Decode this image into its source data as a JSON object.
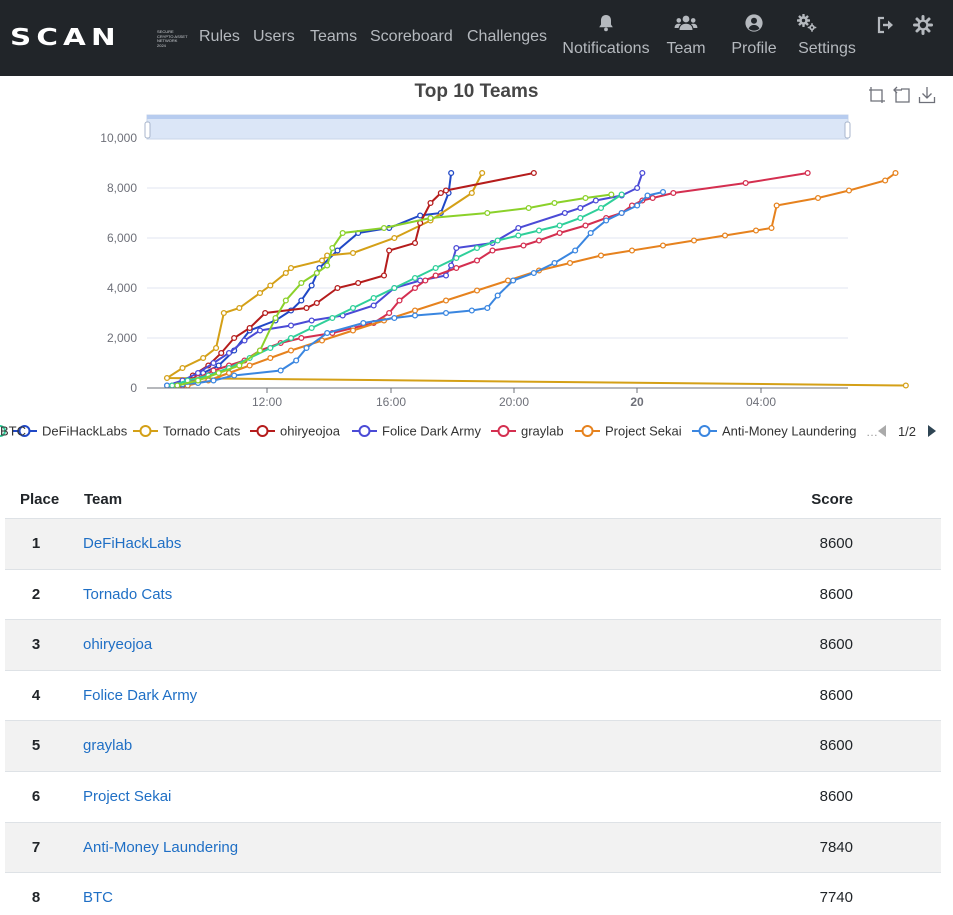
{
  "navbar": {
    "brand": "SCAN",
    "brand_subtitle": [
      "SECURE",
      "CRYPTO ASSET",
      "NETWORK",
      "2024"
    ],
    "links": [
      "Rules",
      "Users",
      "Teams",
      "Scoreboard",
      "Challenges"
    ],
    "notifications_label": "Notifications",
    "team_label": "Team",
    "profile_label": "Profile",
    "settings_label": "Settings",
    "icons": {
      "notifications": "bell-icon",
      "team": "users-icon",
      "profile": "user-circle-icon",
      "settings": "cogs-icon",
      "logout": "sign-out-icon",
      "theme": "sun-icon"
    }
  },
  "chart_data": {
    "type": "line",
    "title": "Top 10 Teams",
    "x_tick_labels": [
      "12:00",
      "16:00",
      "20:00",
      "20",
      "04:00"
    ],
    "y_tick_labels": [
      "0",
      "2,000",
      "4,000",
      "6,000",
      "8,000",
      "10,000"
    ],
    "ylim": [
      0,
      10000
    ],
    "legend_position": "bottom",
    "legend_page": "1/2",
    "grid": true,
    "series": [
      {
        "name": "DeFiHackLabs",
        "color": "#2048c6",
        "x": [
          "08:10",
          "08:40",
          "09:10",
          "09:40",
          "10:10",
          "10:40",
          "11:30",
          "12:00",
          "12:20",
          "12:40",
          "12:55",
          "13:30",
          "14:10",
          "15:10",
          "16:10",
          "16:50",
          "17:05",
          "17:10"
        ],
        "y": [
          100,
          300,
          600,
          900,
          1500,
          2300,
          2700,
          3100,
          3500,
          4100,
          4800,
          5500,
          6200,
          6400,
          6900,
          7000,
          7800,
          8600
        ]
      },
      {
        "name": "Tornado Cats",
        "color": "#d4a017",
        "x": [
          "07:50",
          "08:00",
          "08:30",
          "09:10",
          "09:35",
          "09:50",
          "10:20",
          "11:00",
          "11:20",
          "11:50",
          "12:00",
          "13:00",
          "13:10",
          "14:00",
          "15:20",
          "16:30",
          "17:50",
          "18:10"
        ],
        "y": [
          100,
          400,
          800,
          1200,
          1600,
          3000,
          3200,
          3800,
          4100,
          4600,
          4800,
          5100,
          5300,
          5400,
          6000,
          6700,
          7800,
          8600
        ]
      },
      {
        "name": "ohiryeojoa",
        "color": "#b51c1c",
        "x": [
          "08:20",
          "08:50",
          "09:20",
          "09:45",
          "10:10",
          "10:40",
          "11:10",
          "12:30",
          "12:50",
          "13:30",
          "14:10",
          "15:00",
          "15:10",
          "16:00",
          "16:10",
          "16:30",
          "16:50",
          "17:00",
          "19:50"
        ],
        "y": [
          100,
          500,
          900,
          1400,
          2000,
          2400,
          3000,
          3200,
          3400,
          4000,
          4200,
          4500,
          5500,
          5800,
          6600,
          7400,
          7800,
          7900,
          8600
        ]
      },
      {
        "name": "Folice Dark Army",
        "color": "#4b4bd6",
        "x": [
          "08:00",
          "08:30",
          "09:00",
          "09:30",
          "10:00",
          "10:30",
          "11:00",
          "12:00",
          "12:40",
          "13:40",
          "14:40",
          "15:20",
          "16:10",
          "17:00",
          "17:10",
          "17:20",
          "18:30",
          "19:20",
          "20:50",
          "21:20",
          "21:50",
          "22:40",
          "23:10",
          "23:20"
        ],
        "y": [
          100,
          300,
          600,
          1000,
          1400,
          1900,
          2300,
          2500,
          2700,
          2900,
          3300,
          4000,
          4300,
          4500,
          4900,
          5600,
          5800,
          6400,
          7000,
          7200,
          7500,
          7700,
          8000,
          8600
        ]
      },
      {
        "name": "graylab",
        "color": "#d42f50",
        "x": [
          "08:30",
          "09:00",
          "09:30",
          "10:00",
          "10:30",
          "11:00",
          "11:40",
          "12:20",
          "13:20",
          "14:00",
          "14:40",
          "15:10",
          "15:30",
          "16:00",
          "16:20",
          "16:40",
          "17:20",
          "18:00",
          "18:30",
          "19:30",
          "20:00",
          "20:40",
          "21:30",
          "22:10",
          "22:40",
          "23:00",
          "23:20",
          "23:40",
          "00:20",
          "02:40",
          "04:40"
        ],
        "y": [
          100,
          400,
          700,
          900,
          1100,
          1500,
          1800,
          2000,
          2200,
          2400,
          2600,
          3000,
          3500,
          4000,
          4300,
          4500,
          4800,
          5100,
          5500,
          5700,
          5900,
          6200,
          6500,
          6800,
          7000,
          7300,
          7500,
          7600,
          7800,
          8200,
          8600
        ]
      },
      {
        "name": "Project Sekai",
        "color": "#e6821e",
        "x": [
          "08:40",
          "09:20",
          "10:00",
          "10:40",
          "11:20",
          "12:00",
          "13:00",
          "14:00",
          "15:00",
          "16:00",
          "17:00",
          "18:00",
          "19:00",
          "20:00",
          "21:00",
          "22:00",
          "23:00",
          "00:00",
          "01:00",
          "02:00",
          "03:00",
          "03:30",
          "03:40",
          "05:00",
          "06:00",
          "07:10",
          "07:30"
        ],
        "y": [
          100,
          300,
          600,
          900,
          1200,
          1500,
          1900,
          2300,
          2700,
          3100,
          3500,
          3900,
          4300,
          4700,
          5000,
          5300,
          5500,
          5700,
          5900,
          6100,
          6300,
          6400,
          7300,
          7600,
          7900,
          8300,
          8600
        ]
      },
      {
        "name": "Anti-Money Laundering",
        "color": "#3a86e0",
        "x": [
          "08:00",
          "08:30",
          "09:00",
          "09:30",
          "10:10",
          "11:40",
          "12:10",
          "12:30",
          "13:10",
          "14:20",
          "15:20",
          "16:00",
          "17:00",
          "17:50",
          "18:20",
          "18:40",
          "19:10",
          "19:50",
          "20:30",
          "21:10",
          "21:40",
          "22:10",
          "22:40",
          "23:10",
          "23:30",
          "00:00"
        ],
        "y": [
          100,
          150,
          200,
          300,
          500,
          700,
          1100,
          1600,
          2200,
          2600,
          2800,
          2900,
          3000,
          3100,
          3200,
          3700,
          4300,
          4600,
          5000,
          5500,
          6200,
          6700,
          7000,
          7300,
          7700,
          7840
        ]
      },
      {
        "name": "BTC",
        "color": "#2fcf9a",
        "x": [
          "08:10",
          "08:40",
          "09:20",
          "10:00",
          "10:40",
          "11:20",
          "12:00",
          "12:40",
          "13:20",
          "14:00",
          "14:40",
          "15:20",
          "16:00",
          "16:40",
          "17:20",
          "18:00",
          "18:40",
          "19:20",
          "20:00",
          "20:40",
          "21:20",
          "22:00",
          "22:40"
        ],
        "y": [
          100,
          300,
          500,
          800,
          1200,
          1600,
          2000,
          2400,
          2800,
          3200,
          3600,
          4000,
          4400,
          4800,
          5200,
          5600,
          5900,
          6100,
          6300,
          6500,
          6800,
          7200,
          7740
        ]
      },
      {
        "name": "",
        "color": "#8bd12a",
        "x": [
          "08:20",
          "09:00",
          "09:40",
          "10:20",
          "11:00",
          "11:30",
          "11:50",
          "12:20",
          "12:50",
          "13:10",
          "13:20",
          "13:40",
          "15:00",
          "16:30",
          "18:20",
          "19:40",
          "20:30",
          "21:30",
          "22:20"
        ],
        "y": [
          100,
          300,
          600,
          900,
          1500,
          2800,
          3500,
          4200,
          4600,
          4900,
          5600,
          6200,
          6400,
          6800,
          7000,
          7200,
          7400,
          7600,
          7740
        ]
      }
    ]
  },
  "table": {
    "headers": {
      "place": "Place",
      "team": "Team",
      "score": "Score"
    },
    "rows": [
      {
        "place": "1",
        "team": "DeFiHackLabs",
        "score": "8600"
      },
      {
        "place": "2",
        "team": "Tornado Cats",
        "score": "8600"
      },
      {
        "place": "3",
        "team": "ohiryeojoa",
        "score": "8600"
      },
      {
        "place": "4",
        "team": "Folice Dark Army",
        "score": "8600"
      },
      {
        "place": "5",
        "team": "graylab",
        "score": "8600"
      },
      {
        "place": "6",
        "team": "Project Sekai",
        "score": "8600"
      },
      {
        "place": "7",
        "team": "Anti-Money Laundering",
        "score": "7840"
      },
      {
        "place": "8",
        "team": "BTC",
        "score": "7740"
      }
    ]
  }
}
